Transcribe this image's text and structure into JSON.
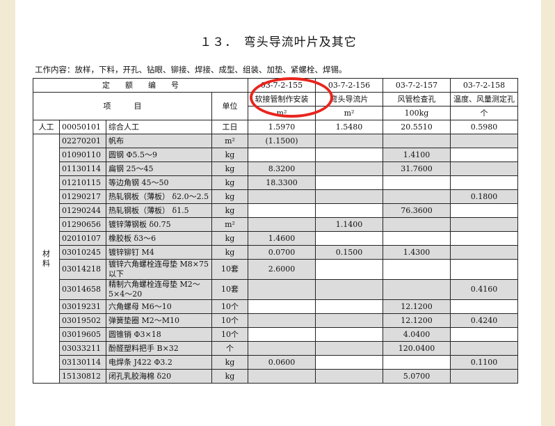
{
  "title": "１３．　弯头导流叶片及其它",
  "work_content": "工作内容：放样，下料，开孔、钻眼、铆接、焊接、成型、组装、加垫、紧螺栓、焊锡。",
  "header": {
    "quota_label": "定　　额　　编　　号",
    "item_label": "项　　　目",
    "unit_label": "单位",
    "codes": [
      "03-7-2-155",
      "03-7-2-156",
      "03-7-2-157",
      "03-7-2-158"
    ],
    "names": [
      "软接管制作安装",
      "弯头导流片",
      "风管检查孔",
      "温度、风量测定孔"
    ],
    "units": [
      "m²",
      "m²",
      "100kg",
      "个"
    ]
  },
  "labor": {
    "category": "人工",
    "code": "00050101",
    "name": "综合人工",
    "unit": "工日",
    "values": [
      "1.5970",
      "1.5480",
      "20.5510",
      "0.5980"
    ]
  },
  "materials_category": "材料",
  "materials": [
    {
      "code": "02270201",
      "name": "帆布",
      "unit": "m²",
      "values": [
        "(1.1500)",
        "",
        "",
        ""
      ]
    },
    {
      "code": "01090110",
      "name": "圆钢 Φ5.5～9",
      "unit": "kg",
      "values": [
        "",
        "",
        "1.4100",
        ""
      ]
    },
    {
      "code": "01130114",
      "name": "扁钢 25～45",
      "unit": "kg",
      "values": [
        "8.3200",
        "",
        "31.7600",
        ""
      ]
    },
    {
      "code": "01210115",
      "name": "等边角钢 45～50",
      "unit": "kg",
      "values": [
        "18.3300",
        "",
        "",
        ""
      ]
    },
    {
      "code": "01290217",
      "name": "热轧钢板（薄板） δ2.0～2.5",
      "unit": "kg",
      "values": [
        "",
        "",
        "",
        "0.1800"
      ],
      "tall": true
    },
    {
      "code": "01290244",
      "name": "热轧钢板（薄板） δ1.5",
      "unit": "kg",
      "values": [
        "",
        "",
        "76.3600",
        ""
      ]
    },
    {
      "code": "01290656",
      "name": "镀锌薄钢板 δ0.75",
      "unit": "m²",
      "values": [
        "",
        "1.1400",
        "",
        ""
      ]
    },
    {
      "code": "02010107",
      "name": "橡胶板 δ3～6",
      "unit": "kg",
      "values": [
        "1.4600",
        "",
        "",
        ""
      ]
    },
    {
      "code": "03010245",
      "name": "镀锌铆钉 M4",
      "unit": "kg",
      "values": [
        "0.0700",
        "0.1500",
        "1.4300",
        ""
      ]
    },
    {
      "code": "03014218",
      "name": "镀锌六角螺栓连母垫 M8×75以下",
      "unit": "10套",
      "values": [
        "2.6000",
        "",
        "",
        ""
      ],
      "tall": true
    },
    {
      "code": "03014658",
      "name": "精制六角螺栓连母垫 M2～5×4～20",
      "unit": "10套",
      "values": [
        "",
        "",
        "",
        "0.4160"
      ],
      "tall": true
    },
    {
      "code": "03019231",
      "name": "六角螺母 M6～10",
      "unit": "10个",
      "values": [
        "",
        "",
        "12.1200",
        ""
      ]
    },
    {
      "code": "03019502",
      "name": "弹簧垫圈 M2～M10",
      "unit": "10个",
      "values": [
        "",
        "",
        "12.1200",
        "0.4240"
      ]
    },
    {
      "code": "03019605",
      "name": "圆锥销 Φ3×18",
      "unit": "10个",
      "values": [
        "",
        "",
        "4.0400",
        ""
      ]
    },
    {
      "code": "03033211",
      "name": "酚醛塑料把手 B×32",
      "unit": "个",
      "values": [
        "",
        "",
        "120.0400",
        ""
      ]
    },
    {
      "code": "03130114",
      "name": "电焊条 J422 Φ3.2",
      "unit": "kg",
      "values": [
        "0.0600",
        "",
        "",
        "0.1100"
      ]
    },
    {
      "code": "15130812",
      "name": "闭孔乳胶海棉 δ20",
      "unit": "kg",
      "values": [
        "",
        "",
        "5.0700",
        ""
      ]
    }
  ],
  "colors": {
    "row_shade": "#dcdcdc",
    "annotation_circle": "#e8251d",
    "background": "#f3ead3"
  }
}
